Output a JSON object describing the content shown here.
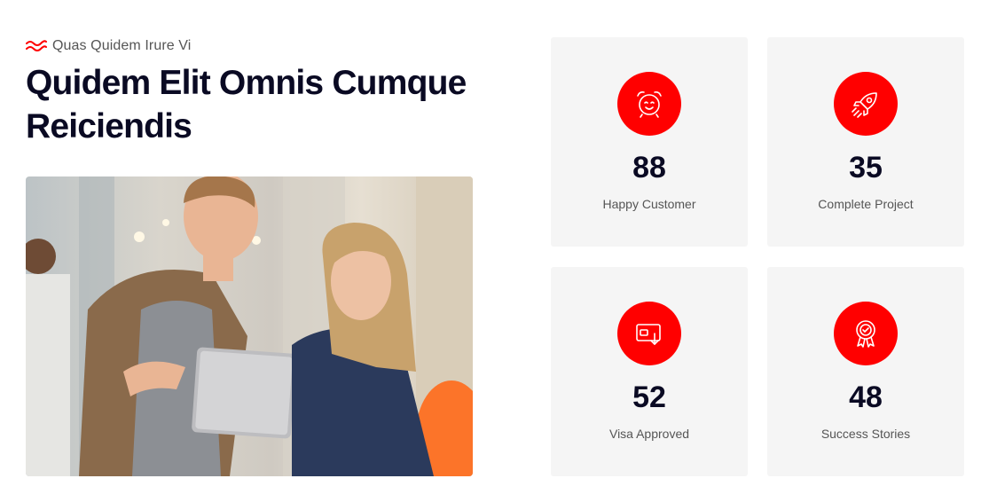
{
  "section": {
    "eyebrow": "Quas Quidem Irure Vi",
    "title": "Quidem Elit Omnis Cumque Reiciendis",
    "eyebrow_icon": "wave-icon",
    "accent_color": "#ff0000"
  },
  "stats": [
    {
      "value": "88",
      "label": "Happy Customer",
      "icon": "alarm-clock-icon"
    },
    {
      "value": "35",
      "label": "Complete Project",
      "icon": "rocket-icon"
    },
    {
      "value": "52",
      "label": "Visa Approved",
      "icon": "wallet-download-icon"
    },
    {
      "value": "48",
      "label": "Success Stories",
      "icon": "award-badge-icon"
    }
  ]
}
